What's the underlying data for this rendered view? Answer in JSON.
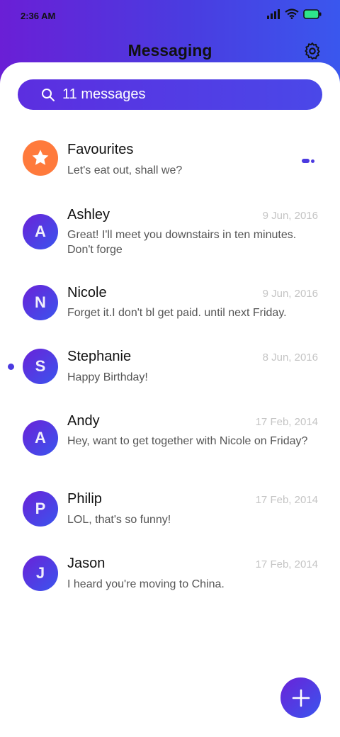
{
  "status_bar": {
    "time": "2:36 AM"
  },
  "header": {
    "title": "Messaging"
  },
  "search": {
    "label": "11 messages"
  },
  "conversations": [
    {
      "name": "Favourites",
      "date": "",
      "preview": "Let's eat out, shall we?",
      "avatar": "star-icon",
      "avatar_color": "#ff7a3c"
    },
    {
      "name": "Ashley",
      "date": "9 Jun, 2016",
      "preview": "Great! I'll meet you downstairs in ten minutes. Don't forge",
      "avatar": "A"
    },
    {
      "name": "Nicole",
      "date": "9 Jun, 2016",
      "preview": "Forget it.I don't bl get paid. until next Friday.",
      "avatar": "N"
    },
    {
      "name": "Stephanie",
      "date": "8 Jun, 2016",
      "preview": "Happy Birthday!",
      "avatar": "S",
      "unread": true
    },
    {
      "name": "Andy",
      "date": "17 Feb, 2014",
      "preview": "Hey, want to get together with Nicole on Friday?",
      "avatar": "A"
    },
    {
      "name": "Philip",
      "date": "17 Feb, 2014",
      "preview": "LOL, that's so funny!",
      "avatar": "P"
    },
    {
      "name": "Jason",
      "date": "17 Feb, 2014",
      "preview": "I heard you're moving to China.",
      "avatar": "J"
    }
  ],
  "colors": {
    "accent": "#4b3ae0",
    "favourite": "#ff7a3c"
  }
}
